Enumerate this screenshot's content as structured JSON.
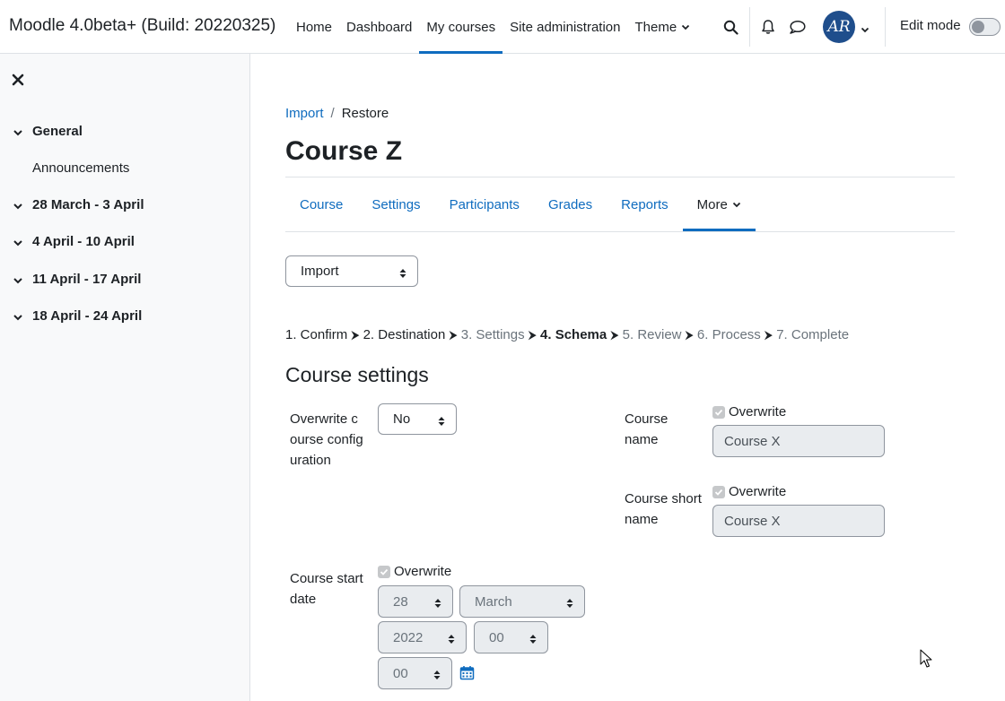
{
  "navbar": {
    "brand": "Moodle 4.0beta+ (Build: 20220325)",
    "items": [
      {
        "label": "Home"
      },
      {
        "label": "Dashboard"
      },
      {
        "label": "My courses",
        "active": true
      },
      {
        "label": "Site administration"
      },
      {
        "label": "Theme"
      }
    ],
    "avatar_initials": "AR",
    "edit_mode_label": "Edit mode",
    "edit_mode_on": false
  },
  "drawer": {
    "sections": [
      {
        "label": "General",
        "items": [
          "Announcements"
        ]
      },
      {
        "label": "28 March - 3 April"
      },
      {
        "label": "4 April - 10 April"
      },
      {
        "label": "11 April - 17 April"
      },
      {
        "label": "18 April - 24 April"
      }
    ]
  },
  "breadcrumb": {
    "link": "Import",
    "separator": "/",
    "current": "Restore"
  },
  "page_title": "Course Z",
  "secondary_nav": {
    "tabs": [
      "Course",
      "Settings",
      "Participants",
      "Grades",
      "Reports"
    ],
    "more_label": "More"
  },
  "action_select": {
    "value": "Import"
  },
  "steps": {
    "items": [
      "1. Confirm",
      "2. Destination",
      "3. Settings",
      "4. Schema",
      "5. Review",
      "6. Process",
      "7. Complete"
    ],
    "current_index": 3
  },
  "course_settings": {
    "heading": "Course settings",
    "overwrite_config": {
      "label": "Overwrite course configuration",
      "value": "No"
    },
    "course_name": {
      "label": "Course name",
      "overwrite_label": "Overwrite",
      "value": "Course X"
    },
    "course_short_name": {
      "label": "Course short name",
      "overwrite_label": "Overwrite",
      "value": "Course X"
    },
    "start_date": {
      "label": "Course start date",
      "overwrite_label": "Overwrite",
      "day": "28",
      "month": "March",
      "year": "2022",
      "hour": "00",
      "minute": "00"
    }
  },
  "colors": {
    "accent": "#0f6cbf",
    "text": "#1d2125",
    "muted": "#6a737b",
    "drawer_bg": "#f8f9fa",
    "disabled_bg": "#e9ecef",
    "avatar_bg": "#1f4e8c"
  },
  "icons": [
    "search-icon",
    "bell-icon",
    "chat-icon",
    "close-icon",
    "chevron-down-icon",
    "calendar-icon"
  ]
}
